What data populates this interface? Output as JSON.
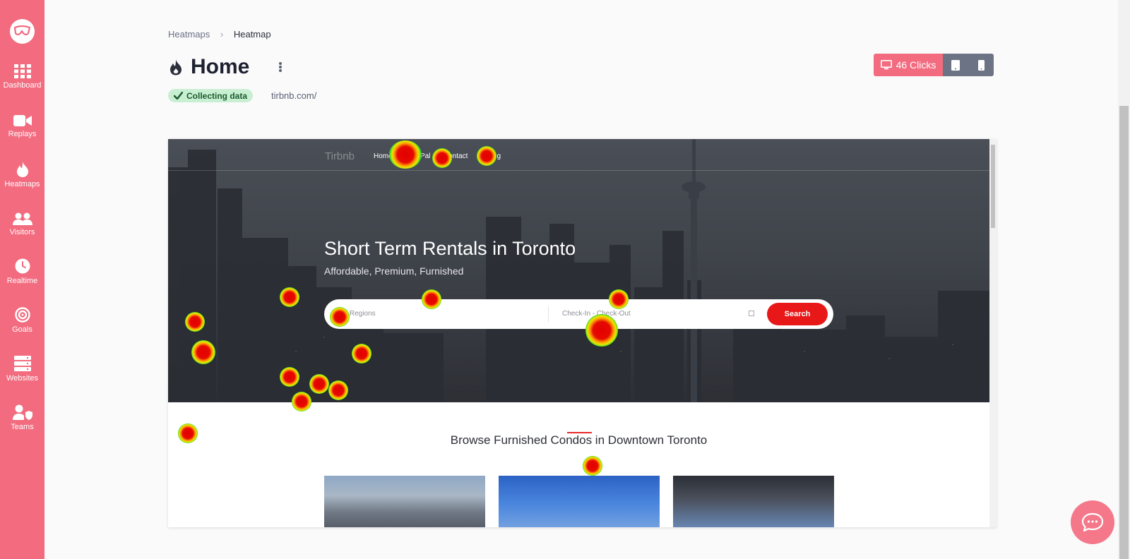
{
  "sidebar": {
    "items": [
      {
        "label": "Dashboard",
        "icon": "grid-icon"
      },
      {
        "label": "Replays",
        "icon": "video-camera-icon"
      },
      {
        "label": "Heatmaps",
        "icon": "flame-icon"
      },
      {
        "label": "Visitors",
        "icon": "users-icon"
      },
      {
        "label": "Realtime",
        "icon": "clock-icon"
      },
      {
        "label": "Goals",
        "icon": "target-icon"
      },
      {
        "label": "Websites",
        "icon": "server-icon"
      },
      {
        "label": "Teams",
        "icon": "team-shield-icon"
      }
    ]
  },
  "breadcrumb": {
    "items": [
      "Heatmaps",
      "Heatmap"
    ],
    "separator": "›"
  },
  "header": {
    "title": "Home",
    "status": "Collecting data",
    "url": "tirbnb.com/"
  },
  "device_toggle": {
    "desktop_label": "46 Clicks",
    "active": "desktop"
  },
  "preview": {
    "site_logo": "Tirbnb",
    "nav_links": [
      "Home",
      "BnBPal",
      "Contact",
      "Blog"
    ],
    "hero_title": "Short Term Rentals in Toronto",
    "hero_subtitle": "Affordable, Premium, Furnished",
    "search": {
      "region_placeholder": "All Regions",
      "dates_placeholder": "Check-In - Check-Out",
      "button_label": "Search"
    },
    "section_title": "Browse Furnished Condos in Downtown Toronto"
  },
  "colors": {
    "sidebar": "#f26b7f",
    "accent": "#f26b7f",
    "status_bg": "#c9efd2",
    "search_button": "#e81818",
    "device_inactive": "#6b7384"
  }
}
